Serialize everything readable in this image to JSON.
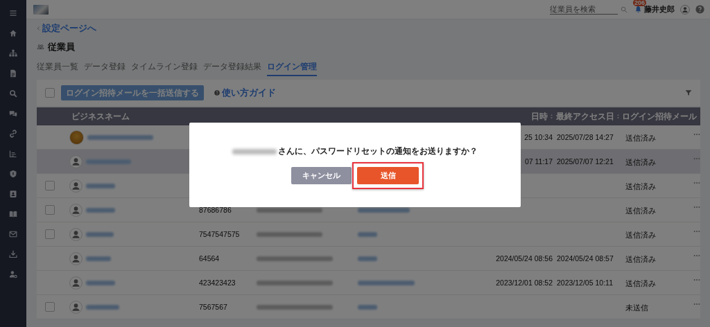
{
  "topbar": {
    "search": {
      "placeholder": "従業員を検索"
    },
    "notification_count": "206",
    "user_name": "藤井史郎"
  },
  "breadcrumb": "設定ページへ",
  "page_title": "従業員",
  "tabs": [
    {
      "label": "従業員一覧",
      "selected": false
    },
    {
      "label": "データ登録",
      "selected": false
    },
    {
      "label": "タイムライン登録",
      "selected": false
    },
    {
      "label": "データ登録結果",
      "selected": false
    },
    {
      "label": "ログイン管理",
      "selected": true
    }
  ],
  "toolbar": {
    "select_all_checked": false,
    "bulk_send_button": {
      "label": "ログイン招待メールを一括送信する",
      "disabled": true
    },
    "guide_link": "使い方ガイド"
  },
  "table": {
    "columns": [
      {
        "label": "ビジネスネーム",
        "sortable": false
      },
      {
        "label": "日時",
        "sortable": true
      },
      {
        "label": "最終アクセス日",
        "sortable": true
      },
      {
        "label": "ログイン招待メール",
        "sortable": false
      }
    ],
    "rows": [
      {
        "selectable": false,
        "highlighted": false,
        "has_photo": true,
        "column_3": null,
        "last_login": "25 10:34",
        "last_access": "2025/07/28 14:27",
        "invite_mail": "送信済み"
      },
      {
        "selectable": false,
        "highlighted": true,
        "has_photo": false,
        "column_3": null,
        "last_login": "07 11:17",
        "last_access": "2025/07/07 12:21",
        "invite_mail": "送信済み"
      },
      {
        "selectable": true,
        "checked": false,
        "highlighted": false,
        "has_photo": false,
        "column_3": null,
        "last_login": null,
        "last_access": null,
        "invite_mail": "送信済み"
      },
      {
        "selectable": true,
        "checked": false,
        "highlighted": false,
        "has_photo": false,
        "column_3": "87686786",
        "last_login": null,
        "last_access": null,
        "invite_mail": "送信済み"
      },
      {
        "selectable": true,
        "checked": false,
        "highlighted": false,
        "has_photo": false,
        "column_3": "7547547575",
        "last_login": null,
        "last_access": null,
        "invite_mail": "送信済み"
      },
      {
        "selectable": false,
        "highlighted": false,
        "has_photo": false,
        "column_3": "64564",
        "last_login": "2024/05/24 08:56",
        "last_access": "2024/05/24 08:57",
        "invite_mail": "送信済み"
      },
      {
        "selectable": false,
        "highlighted": false,
        "has_photo": false,
        "column_3": "423423423",
        "last_login": "2023/12/01 08:52",
        "last_access": "2023/12/05 10:11",
        "invite_mail": "送信済み"
      },
      {
        "selectable": true,
        "checked": false,
        "highlighted": false,
        "has_photo": false,
        "column_3": "7567567",
        "last_login": null,
        "last_access": null,
        "invite_mail": "未送信"
      }
    ]
  },
  "dialog": {
    "message": "さんに、パスワードリセットの通知をお送りますか？",
    "buttons": [
      {
        "label": "キャンセル",
        "kind": "cancel",
        "highlighted": false
      },
      {
        "label": "送信",
        "kind": "primary",
        "highlighted": true
      }
    ]
  }
}
